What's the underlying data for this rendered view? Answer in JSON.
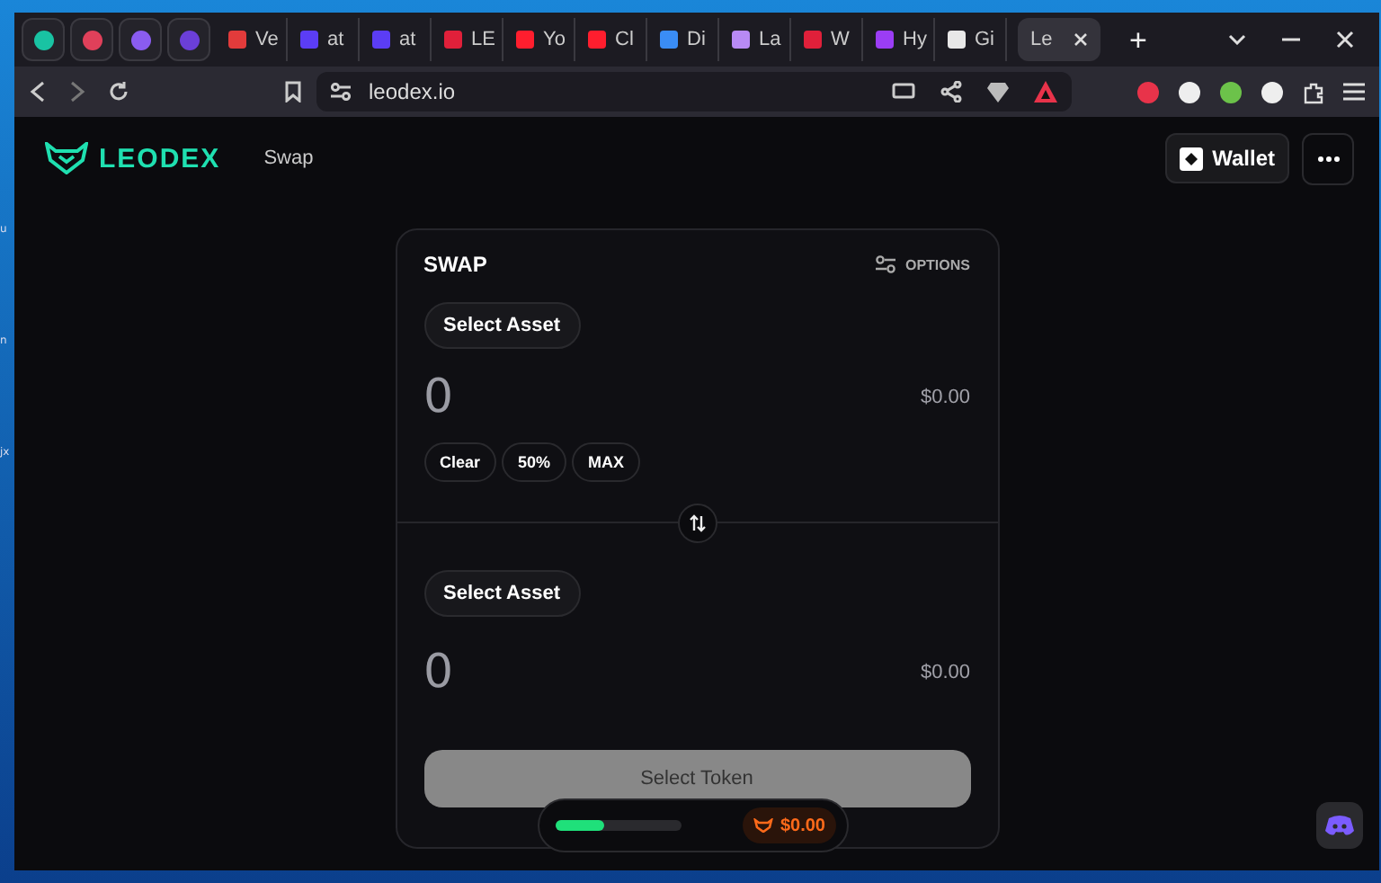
{
  "desktop": {
    "labels": [
      "u",
      "n",
      "jx"
    ]
  },
  "browser": {
    "pinned_tabs": [
      {
        "color": "#19c3a3"
      },
      {
        "color": "#e0405a"
      },
      {
        "color": "#8a5cf0"
      },
      {
        "color": "#6b3fd8"
      }
    ],
    "tabs": [
      {
        "title": "Ve",
        "color": "#e23b3b",
        "selected": false
      },
      {
        "title": "at",
        "color": "#5b3df5",
        "selected": false
      },
      {
        "title": "at",
        "color": "#5b3df5",
        "selected": false
      },
      {
        "title": "LE",
        "color": "#e0203a",
        "selected": false
      },
      {
        "title": "Yo",
        "color": "#ff1e2e",
        "selected": false
      },
      {
        "title": "Cl",
        "color": "#ff1e2e",
        "selected": false
      },
      {
        "title": "Di",
        "color": "#3a8df5",
        "selected": false
      },
      {
        "title": "La",
        "color": "#b88af5",
        "selected": false
      },
      {
        "title": "W",
        "color": "#e0203a",
        "selected": false
      },
      {
        "title": "Hy",
        "color": "#9b3df5",
        "selected": false
      },
      {
        "title": "Gi",
        "color": "#e8e8e8",
        "selected": false
      },
      {
        "title": "Le",
        "selected": true
      }
    ],
    "new_tab": "+",
    "url": "leodex.io"
  },
  "app": {
    "logo": "LEODEX",
    "nav": [
      {
        "label": "Swap"
      }
    ],
    "wallet_button": "Wallet",
    "swap": {
      "title": "SWAP",
      "options": "OPTIONS",
      "from": {
        "asset_button": "Select Asset",
        "amount": "0",
        "usd": "$0.00",
        "quick": [
          "Clear",
          "50%",
          "MAX"
        ]
      },
      "to": {
        "asset_button": "Select Asset",
        "amount": "0",
        "usd": "$0.00"
      },
      "submit": {
        "label": "Select Token",
        "disabled": true
      }
    },
    "footer_pill": {
      "level": 0.38,
      "balance": "$0.00"
    }
  }
}
